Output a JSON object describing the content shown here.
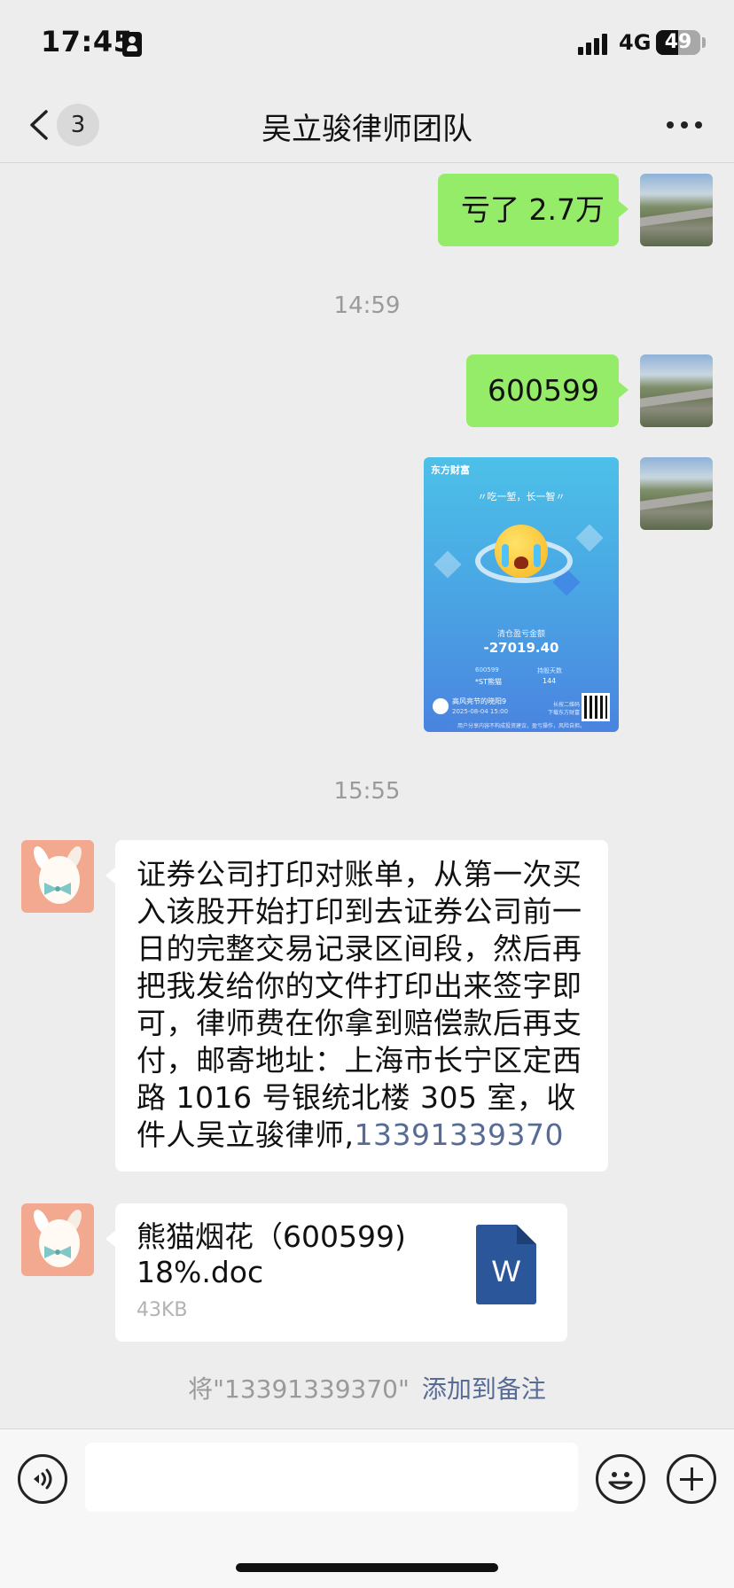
{
  "status_bar": {
    "time": "17:45",
    "network": "4G",
    "battery": "49",
    "battery_level": 0.49
  },
  "nav": {
    "unread_count": "3",
    "title": "吴立骏律师团队"
  },
  "messages": {
    "m1": "亏了 2.7万",
    "ts1": "14:59",
    "m2": "600599",
    "ts2": "15:55",
    "m3_text": "证券公司打印对账单，从第一次买入该股开始打印到去证券公司前一日的完整交易记录区间段，然后再把我发给你的文件打印出来签字即可，律师费在你拿到赔偿款后再支付，邮寄地址：上海市长宁区定西路 1016 号银统北楼 305 室，收件人吴立骏律师,",
    "m3_phone": "13391339370",
    "file_name": "熊猫烟花（600599) 18%.doc",
    "file_size": "43KB",
    "file_icon_letter": "W"
  },
  "image_card": {
    "brand": "东方财富",
    "slogan": "〃吃一堑，长一智〃",
    "label": "清仓盈亏金额",
    "amount": "-27019.40",
    "code": "600599",
    "stock_name": "*ST熊猫",
    "days_label": "持股天数",
    "days": "144",
    "user": "高风亮节的晓阳9",
    "date": "2025-08-04 15:00",
    "scan_text": "长按二维码 下载东方财富",
    "footer": "用户分享内容不构成投资建议，盈亏操作，风险自担。"
  },
  "system_note": {
    "text": "将\"13391339370\"",
    "action": "添加到备注"
  },
  "colors": {
    "bubble_green": "#95ec69",
    "link": "#576b95",
    "background": "#ededed"
  }
}
